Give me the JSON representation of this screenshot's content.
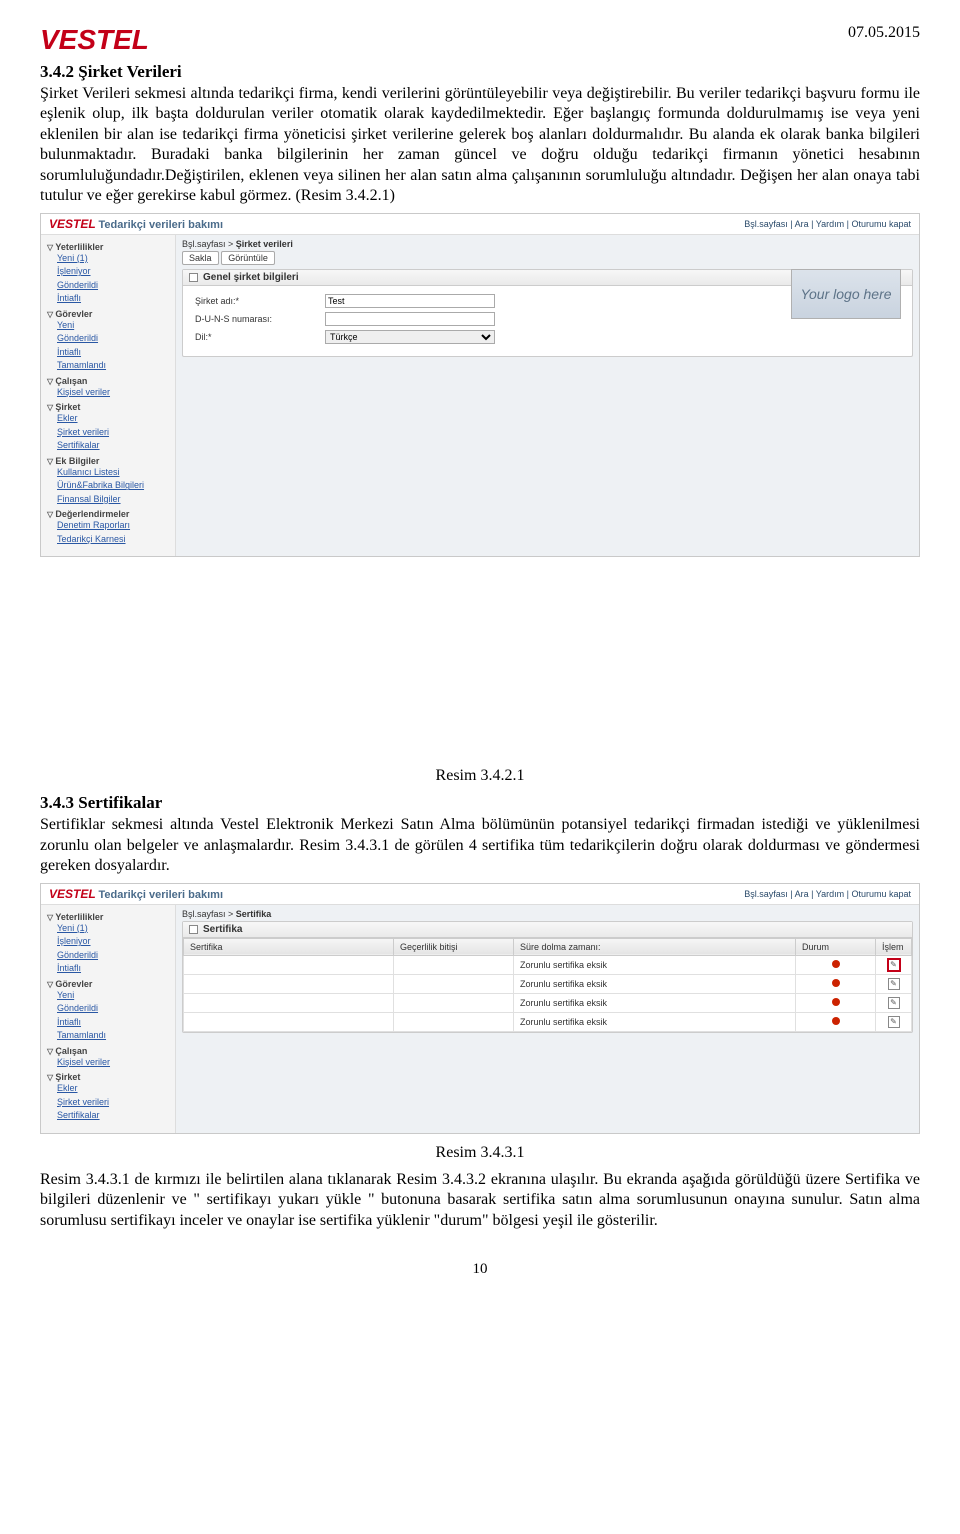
{
  "header": {
    "logo": "VESTEL",
    "date": "07.05.2015"
  },
  "sec1": {
    "title": "3.4.2 Şirket Verileri",
    "para": "Şirket Verileri sekmesi altında tedarikçi firma, kendi verilerini görüntüleyebilir veya değiştirebilir. Bu veriler tedarikçi başvuru formu ile eşlenik olup, ilk başta doldurulan veriler otomatik olarak kaydedilmektedir. Eğer başlangıç formunda doldurulmamış ise veya yeni eklenilen bir alan ise tedarikçi firma yöneticisi şirket verilerine gelerek boş alanları doldurmalıdır. Bu alanda ek olarak banka bilgileri bulunmaktadır. Buradaki banka bilgilerinin her zaman güncel ve doğru olduğu tedarikçi firmanın yönetici hesabının sorumluluğundadır.Değiştirilen, eklenen veya silinen her alan satın alma çalışanının sorumluluğu altındadır. Değişen her alan onaya tabi tutulur ve eğer gerekirse kabul görmez. (Resim 3.4.2.1)"
  },
  "shot1": {
    "appTitle": "Tedarikçi verileri bakımı",
    "links": "Bşl.sayfası | Ara | Yardım | Oturumu kapat",
    "crumb_pre": "Bşl.sayfası > ",
    "crumb_cur": "Şirket verileri",
    "btn_save": "Sakla",
    "btn_view": "Görüntüle",
    "panel_title": "Genel şirket bilgileri",
    "f_name": "Şirket adı:*",
    "v_name": "Test",
    "f_duns": "D-U-N-S numarası:",
    "v_duns": "",
    "f_lang": "Dil:*",
    "v_lang": "Türkçe",
    "logo_ph": "Your logo here",
    "side": {
      "g1": "Yeterlilikler",
      "g1i": [
        "Yeni (1)",
        "İşleniyor",
        "Gönderildi",
        "İntiaflı"
      ],
      "g2": "Görevler",
      "g2i": [
        "Yeni",
        "Gönderildi",
        "İntiaflı",
        "Tamamlandı"
      ],
      "g3": "Çalışan",
      "g3i": [
        "Kişisel veriler"
      ],
      "g4": "Şirket",
      "g4i": [
        "Ekler",
        "Şirket verileri",
        "Sertifikalar"
      ],
      "g5": "Ek Bilgiler",
      "g5i": [
        "Kullanıcı Listesi",
        "Ürün&Fabrika Bilgileri",
        "Finansal Bilgiler"
      ],
      "g6": "Değerlendirmeler",
      "g6i": [
        "Denetim Raporları",
        "Tedarikçi Karnesi"
      ]
    }
  },
  "caption1": "Resim 3.4.2.1",
  "sec2": {
    "title": "3.4.3 Sertifikalar",
    "para": "Sertifiklar sekmesi altında Vestel Elektronik Merkezi Satın Alma bölümünün potansiyel tedarikçi firmadan istediği ve yüklenilmesi zorunlu olan belgeler ve anlaşmalardır. Resim 3.4.3.1 de görülen 4 sertifika tüm tedarikçilerin doğru olarak doldurması ve göndermesi gereken dosyalardır."
  },
  "shot2": {
    "appTitle": "Tedarikçi verileri bakımı",
    "links": "Bşl.sayfası | Ara | Yardım | Oturumu kapat",
    "crumb_pre": "Bşl.sayfası > ",
    "crumb_cur": "Sertifika",
    "panel_title": "Sertifika",
    "th_cert": "Sertifika",
    "th_validity": "Geçerlilik bitişi",
    "th_due": "Süre dolma zamanı:",
    "th_status": "Durum",
    "th_action": "İşlem",
    "row_text": "Zorunlu sertifika eksik",
    "side": {
      "g1": "Yeterlilikler",
      "g1i": [
        "Yeni (1)",
        "İşleniyor",
        "Gönderildi",
        "İntiaflı"
      ],
      "g2": "Görevler",
      "g2i": [
        "Yeni",
        "Gönderildi",
        "İntiaflı",
        "Tamamlandı"
      ],
      "g3": "Çalışan",
      "g3i": [
        "Kişisel veriler"
      ],
      "g4": "Şirket",
      "g4i": [
        "Ekler",
        "Şirket verileri",
        "Sertifikalar"
      ]
    }
  },
  "caption2": "Resim 3.4.3.1",
  "sec3": {
    "para": "Resim 3.4.3.1 de kırmızı ile belirtilen alana tıklanarak Resim 3.4.3.2 ekranına ulaşılır. Bu ekranda aşağıda görüldüğü üzere Sertifika ve bilgileri düzenlenir ve \" sertifikayı yukarı yükle \" butonuna basarak sertifika satın alma sorumlusunun onayına sunulur. Satın alma sorumlusu sertifikayı inceler ve onaylar ise sertifika yüklenir \"durum\" bölgesi yeşil ile gösterilir."
  },
  "pagenum": "10"
}
